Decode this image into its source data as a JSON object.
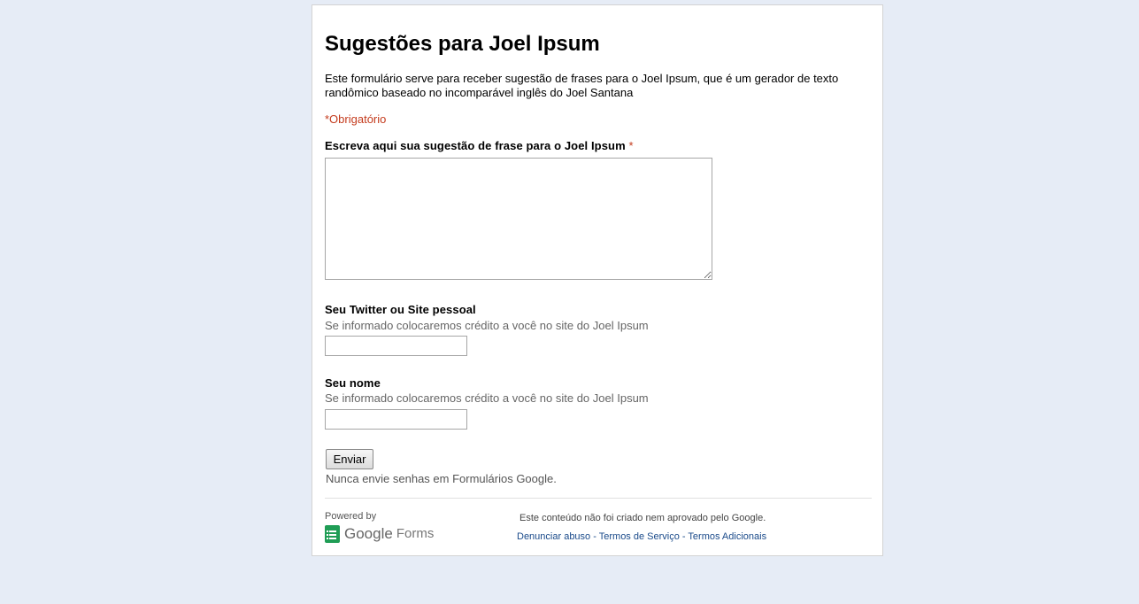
{
  "form": {
    "title": "Sugestões para Joel Ipsum",
    "description": "Este formulário serve para receber sugestão de frases para o Joel Ipsum, que é um gerador de texto randômico baseado no incomparável inglês do Joel Santana",
    "required_note": "*Obrigatório",
    "questions": [
      {
        "label": "Escreva aqui sua sugestão de frase para o Joel Ipsum",
        "required_mark": "*",
        "help": "",
        "value": ""
      },
      {
        "label": "Seu Twitter ou Site pessoal",
        "help": "Se informado colocaremos crédito a você no site do Joel Ipsum",
        "value": ""
      },
      {
        "label": "Seu nome",
        "help": "Se informado colocaremos crédito a você no site do Joel Ipsum",
        "value": ""
      }
    ],
    "submit_label": "Enviar",
    "password_warning": "Nunca envie senhas em Formulários Google."
  },
  "footer": {
    "powered_by": "Powered by",
    "logo_google": "Google",
    "logo_forms": "Forms",
    "disclaimer": "Este conteúdo não foi criado nem aprovado pelo Google.",
    "links": [
      "Denunciar abuso",
      "Termos de Serviço",
      "Termos Adicionais"
    ],
    "link_separator": " - "
  },
  "colors": {
    "page_background": "#e6ecf6",
    "required": "#c43b1d",
    "link": "#1a4a8a",
    "forms_icon": "#1f9d55"
  },
  "icons": {
    "logo": "google-forms-icon"
  }
}
